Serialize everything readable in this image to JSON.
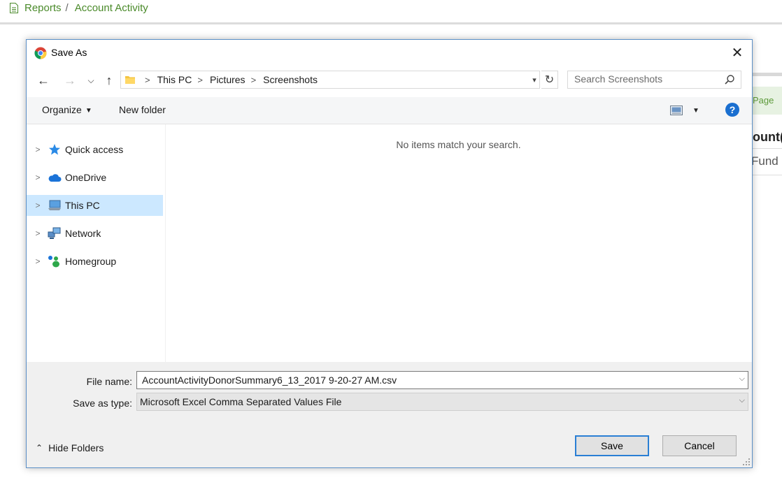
{
  "background": {
    "breadcrumb": {
      "root": "Reports",
      "separator": "/",
      "current": "Account Activity"
    },
    "tab_text": "Page",
    "heading_fragment": "ount(",
    "subtext_fragment": "Fund -"
  },
  "dialog": {
    "title": "Save As",
    "address": {
      "parts": [
        "This PC",
        "Pictures",
        "Screenshots"
      ]
    },
    "search": {
      "placeholder": "Search Screenshots"
    },
    "toolbar": {
      "organize": "Organize",
      "new_folder": "New folder",
      "help": "?"
    },
    "nav": [
      {
        "label": "Quick access",
        "icon": "star-icon",
        "selected": false
      },
      {
        "label": "OneDrive",
        "icon": "cloud-icon",
        "selected": false
      },
      {
        "label": "This PC",
        "icon": "computer-icon",
        "selected": true
      },
      {
        "label": "Network",
        "icon": "network-icon",
        "selected": false
      },
      {
        "label": "Homegroup",
        "icon": "homegroup-icon",
        "selected": false
      }
    ],
    "content": {
      "empty_message": "No items match your search."
    },
    "file_name": {
      "label": "File name:",
      "value": "AccountActivityDonorSummary6_13_2017 9-20-27 AM.csv"
    },
    "save_as_type": {
      "label": "Save as type:",
      "value": "Microsoft Excel Comma Separated Values File"
    },
    "hide_folders": "Hide Folders",
    "buttons": {
      "save": "Save",
      "cancel": "Cancel"
    }
  },
  "colors": {
    "accent": "#2a7fd4",
    "selection": "#cce8ff",
    "link_green": "#4a8a2a"
  }
}
